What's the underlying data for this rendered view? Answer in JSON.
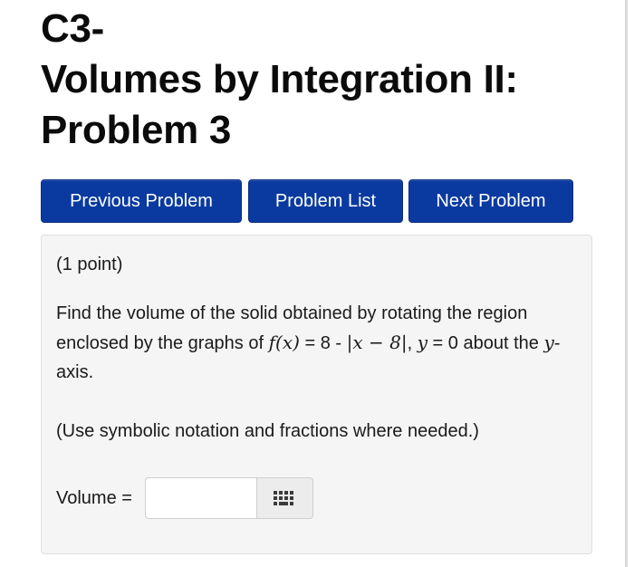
{
  "page": {
    "title_line1": "C3-",
    "title_line2": "Volumes by Integration II:",
    "title_line3": "Problem 3"
  },
  "nav": {
    "previous_label": "Previous Problem",
    "list_label": "Problem List",
    "next_label": "Next Problem"
  },
  "problem": {
    "points": "(1 point)",
    "q_part1": "Find the volume of the solid obtained by rotating the region enclosed by the graphs of ",
    "q_fx": "f(x)",
    "q_eq": " = 8 - ",
    "q_abs": "|x − 8|",
    "q_comma": ", ",
    "q_y": "y",
    "q_part2": " = 0 about the ",
    "q_yaxis_var": "y",
    "q_part3": "-axis.",
    "note": "(Use symbolic notation and fractions where needed.)",
    "answer_label": "Volume =",
    "answer_value": "",
    "keyboard_icon": "keyboard-icon"
  },
  "colors": {
    "button_bg": "#0a3aa0",
    "panel_bg": "#f5f5f5"
  }
}
